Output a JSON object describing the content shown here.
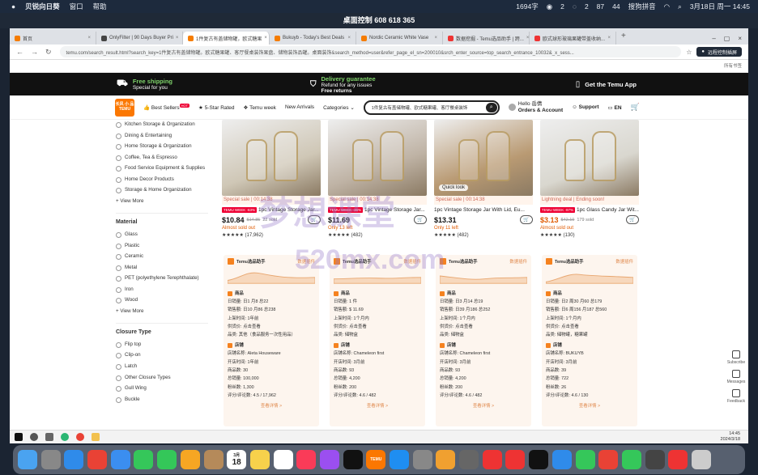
{
  "mac": {
    "app_name": "贝锐向日葵",
    "menu": [
      "窗口",
      "帮助"
    ],
    "status_text": "1694字",
    "battery": "87",
    "wifi_count": "44",
    "ime": "搜狗拼音",
    "datetime": "3月18日 周一 14:45",
    "badge_a": "2",
    "badge_b": "2"
  },
  "remote_title": "桌面控制 608 618 365",
  "tabs": [
    {
      "label": "首页",
      "active": false
    },
    {
      "label": "OnlyFilter | 90 Days Buyer Pri",
      "active": false
    },
    {
      "label": "1件复古有盖储物罐，欧式糖果",
      "active": true
    },
    {
      "label": "Bukuyb - Today's Best Deals",
      "active": false
    },
    {
      "label": "Nordic Ceramic White Vase",
      "active": false
    },
    {
      "label": "数据挖掘 - Temu选品助手 | 跨...",
      "active": false
    },
    {
      "label": "欧式球形玻璃果罐带盖收纳...",
      "active": false
    }
  ],
  "address": {
    "url": "temu.com/search_result.html?search_key=1件复古有盖储物罐。欧式糖果罐、客厅餐桌装饰果盘、储物装饰品罐。桌面装饰&search_method=user&refer_page_el_sn=200010&srch_enter_source=top_search_entrance_10032&_x_sess...",
    "remote_btn": "远程控制插屏"
  },
  "bookmarks_text": "所有书签",
  "promo": {
    "shipping_title": "Free shipping",
    "shipping_sub": "Special for you",
    "delivery_title": "Delivery guarantee",
    "delivery_sub": "Refund for any issues",
    "returns_title": "Free returns",
    "app_label": "Get the Temu App"
  },
  "header": {
    "logo_top": "长风 小 品",
    "logo_bottom": "TEMU",
    "best_sellers": "Best Sellers",
    "best_badge": "HOT",
    "five_star": "5-Star Rated",
    "temu_week": "Temu week",
    "new_arrivals": "New Arrivals",
    "categories": "Categories",
    "search_value": "1件复古有盖储物罐、欧式糖果罐、客厅餐桌装饰",
    "hello": "Hello 岳倩",
    "orders": "Orders & Account",
    "support": "Support",
    "lang": "EN"
  },
  "sidebar": {
    "categories": [
      "Kitchen Storage & Organization",
      "Dining & Entertaining",
      "Home Storage & Organization",
      "Coffee, Tea & Espresso",
      "Food Service Equipment & Supplies",
      "Home Decor Products",
      "Storage & Home Organization"
    ],
    "view_more": "View More",
    "material_title": "Material",
    "materials": [
      "Glass",
      "Plastic",
      "Ceramic",
      "Metal",
      "PET (polyethylene Terephthalate)",
      "Iron",
      "Wood"
    ],
    "closure_title": "Closure Type",
    "closures": [
      "Flip top",
      "Clip-on",
      "Latch",
      "Other Closure Types",
      "Gull Wing",
      "Buckle"
    ]
  },
  "products": [
    {
      "deal": "Special sale | 00:14:38",
      "tag": "TEMU WEEK -63%",
      "title": "1pc Vintage Storage Jar...",
      "price": "$10.84",
      "old": "$14.85",
      "sold": "22 sold",
      "stock": "Almost sold out",
      "rating": "★★★★★ (17,962)",
      "img": "#cfc7b6"
    },
    {
      "deal": "Special sale | 00:14:38",
      "tag": "TEMU WEEK -36%",
      "title": "1pc Vintage Storage Jar...",
      "price": "$11.69",
      "old": "",
      "sold": "",
      "stock": "Only 13 left",
      "rating": "★★★★★ (482)",
      "img": "#bfb3a5"
    },
    {
      "deal": "Special sale | 00:14:38",
      "tag": "",
      "title": "1pc Vintage Storage Jar With Lid, Eu...",
      "price": "$13.31",
      "old": "",
      "sold": "",
      "stock": "Only 11 left",
      "rating": "★★★★★ (482)",
      "img": "#b99a73",
      "quick": "Quick look"
    },
    {
      "deal": "Lightning deal | Ending soon!",
      "tag": "TEMU WEEK -97%",
      "title": "1pc Glass Candy Jar Wit...",
      "price": "$3.13",
      "old": "$42.19",
      "sold": "179 sold",
      "stock": "Almost sold out",
      "rating": "★★★★★ (130)",
      "img": "#d9d7cf"
    }
  ],
  "panels": [
    {
      "title": "Temu选品助手",
      "link": "数据插件",
      "prod": "商品",
      "l1": "日销量: 日1 月8 总22",
      "l2": "销售额: 日10 月86 总238",
      "l3": "上架时间: 1年前",
      "l4": "供货价: 点击查看",
      "l5": "品类: 其他（食品服务一次性用品）",
      "shop": "店铺",
      "s1": "店铺名称: Aleta Houseware",
      "s2": "开店时间: 1年前",
      "s3": "商品数: 30",
      "s4": "总销量: 100,000",
      "s5": "粉丝数: 1,300",
      "s6": "评分/评论数: 4.5 / 17,962",
      "more": "查看详情 >"
    },
    {
      "title": "Temu选品助手",
      "link": "数据插件",
      "prod": "商品",
      "l1": "日销量: 1 件",
      "l2": "销售额: $ 11.69",
      "l3": "上架时间: 1个月内",
      "l4": "供货价: 点击查看",
      "l5": "品类: 储物盒",
      "shop": "店铺",
      "s1": "店铺名称: Chameleon first",
      "s2": "开店时间: 3月前",
      "s3": "商品数: 93",
      "s4": "总销量: 4,200",
      "s5": "粉丝数: 200",
      "s6": "评分/评论数: 4.6 / 482",
      "more": "查看详情 >"
    },
    {
      "title": "Temu选品助手",
      "link": "数据插件",
      "prod": "商品",
      "l1": "日销量: 日3 月14 总19",
      "l2": "销售额: 日39 月186 总252",
      "l3": "上架时间: 1个月内",
      "l4": "供货价: 点击查看",
      "l5": "品类: 储物盒",
      "shop": "店铺",
      "s1": "店铺名称: Chameleon first",
      "s2": "开店时间: 3月前",
      "s3": "商品数: 93",
      "s4": "总销量: 4,200",
      "s5": "粉丝数: 200",
      "s6": "评分/评论数: 4.6 / 482",
      "more": "查看详情 >"
    },
    {
      "title": "Temu选品助手",
      "link": "数据插件",
      "prod": "商品",
      "l1": "日销量: 日2 周30 月60 总179",
      "l2": "销售额: 日6 周156 月187 总560",
      "l3": "上架时间: 1个月内",
      "l4": "供货价: 点击查看",
      "l5": "品类: 储物罐，糖果罐",
      "shop": "店铺",
      "s1": "店铺名称: BUKUYB",
      "s2": "开店时间: 3月前",
      "s3": "商品数: 39",
      "s4": "总销量: 722",
      "s5": "粉丝数: 26",
      "s6": "评分/评论数: 4.6 / 130",
      "more": "查看详情 >"
    }
  ],
  "floating": {
    "subscribe": "Subscribe",
    "messages": "Messages",
    "feedback": "Feedback"
  },
  "watermark": {
    "cn": "梦想课堂",
    "url": "520mx.com"
  },
  "taskbar": {
    "time": "14:45",
    "date": "2024/3/18"
  },
  "dock": {
    "calendar_day": "18",
    "calendar_month": "3月",
    "temu_label": "TEMU"
  }
}
